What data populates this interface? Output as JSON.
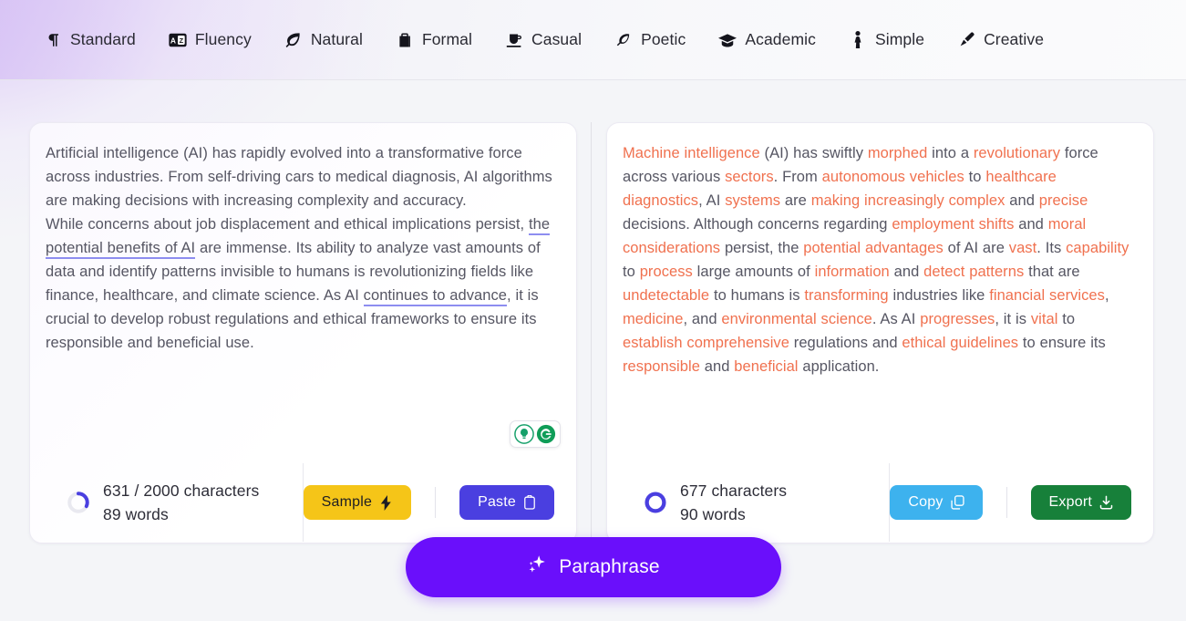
{
  "tabs": [
    {
      "label": "Standard",
      "icon": "pilcrow-icon",
      "active": true
    },
    {
      "label": "Fluency",
      "icon": "translate-icon",
      "active": false
    },
    {
      "label": "Natural",
      "icon": "leaf-icon",
      "active": false
    },
    {
      "label": "Formal",
      "icon": "briefcase-icon",
      "active": false
    },
    {
      "label": "Casual",
      "icon": "coffee-cup-icon",
      "active": false
    },
    {
      "label": "Poetic",
      "icon": "feather-icon",
      "active": false
    },
    {
      "label": "Academic",
      "icon": "graduation-cap-icon",
      "active": false
    },
    {
      "label": "Simple",
      "icon": "person-icon",
      "active": false
    },
    {
      "label": "Creative",
      "icon": "paintbrush-icon",
      "active": false
    }
  ],
  "input_panel": {
    "text_segments": [
      {
        "text": "Artificial intelligence (AI) has rapidly evolved into a transformative force across industries. From self-driving cars to medical diagnosis, AI algorithms are making decisions with increasing complexity and accuracy.",
        "style": "plain"
      },
      {
        "text": "While concerns about job displacement and ethical implications persist, ",
        "style": "plain"
      },
      {
        "text": "the potential benefits of AI",
        "style": "suggestion-underline"
      },
      {
        "text": " are immense. Its ability to analyze vast amounts of data and identify patterns invisible to humans is revolutionizing fields like finance, healthcare, and climate science. As AI ",
        "style": "plain"
      },
      {
        "text": "continues to advance",
        "style": "suggestion-underline"
      },
      {
        "text": ", it is crucial to develop robust regulations and ethical frameworks to ensure its responsible and beneficial use.",
        "style": "plain"
      }
    ],
    "paragraph_1": "Artificial intelligence (AI) has rapidly evolved into a transformative force across industries. From self-driving cars to medical diagnosis, AI algorithms are making decisions with increasing complexity and accuracy.",
    "p2_pre": "While concerns about job displacement and ethical implications persist, ",
    "p2_underline_1": "the potential benefits of AI",
    "p2_mid": " are immense. Its ability to analyze vast amounts of data and identify patterns invisible to humans is revolutionizing fields like finance, healthcare, and climate science. As AI ",
    "p2_underline_2": "continues to advance",
    "p2_post": ", it is crucial to develop robust regulations and ethical frameworks to ensure its responsible and beneficial use.",
    "assist_icons": [
      "lightbulb-icon",
      "grammarly-g-icon"
    ],
    "stats": {
      "characters": "631 / 2000 characters",
      "words": "89 words",
      "char_count": 631,
      "char_limit": 2000,
      "word_count": 89,
      "progress_percent": 32
    },
    "buttons": {
      "sample_label": "Sample",
      "sample_icon": "lightning-bolt-icon",
      "paste_label": "Paste",
      "paste_icon": "clipboard-icon"
    }
  },
  "output_panel": {
    "segments": [
      {
        "t": "Machine intelligence",
        "h": true
      },
      {
        "t": " (AI) has swiftly ",
        "h": false
      },
      {
        "t": "morphed",
        "h": true
      },
      {
        "t": " into a ",
        "h": false
      },
      {
        "t": "revolutionary",
        "h": true
      },
      {
        "t": " force across various ",
        "h": false
      },
      {
        "t": "sectors",
        "h": true
      },
      {
        "t": ". From ",
        "h": false
      },
      {
        "t": "autonomous vehicles",
        "h": true
      },
      {
        "t": " to ",
        "h": false
      },
      {
        "t": "healthcare diagnostics",
        "h": true
      },
      {
        "t": ", AI ",
        "h": false
      },
      {
        "t": "systems",
        "h": true
      },
      {
        "t": " are ",
        "h": false
      },
      {
        "t": "making increasingly complex",
        "h": true
      },
      {
        "t": " and ",
        "h": false
      },
      {
        "t": "precise",
        "h": true
      },
      {
        "t": " decisions. Although concerns regarding ",
        "h": false
      },
      {
        "t": "employment shifts",
        "h": true
      },
      {
        "t": " and ",
        "h": false
      },
      {
        "t": "moral considerations",
        "h": true
      },
      {
        "t": " persist, the ",
        "h": false
      },
      {
        "t": "potential advantages",
        "h": true
      },
      {
        "t": " of AI are ",
        "h": false
      },
      {
        "t": "vast",
        "h": true
      },
      {
        "t": ". Its ",
        "h": false
      },
      {
        "t": "capability",
        "h": true
      },
      {
        "t": " to ",
        "h": false
      },
      {
        "t": "process",
        "h": true
      },
      {
        "t": " large amounts of ",
        "h": false
      },
      {
        "t": "information",
        "h": true
      },
      {
        "t": " and ",
        "h": false
      },
      {
        "t": "detect patterns",
        "h": true
      },
      {
        "t": " that are ",
        "h": false
      },
      {
        "t": "undetectable",
        "h": true
      },
      {
        "t": " to humans is ",
        "h": false
      },
      {
        "t": "transforming",
        "h": true
      },
      {
        "t": " industries like ",
        "h": false
      },
      {
        "t": "financial services",
        "h": true
      },
      {
        "t": ", ",
        "h": false
      },
      {
        "t": "medicine",
        "h": true
      },
      {
        "t": ", and ",
        "h": false
      },
      {
        "t": "environmental science",
        "h": true
      },
      {
        "t": ". As AI ",
        "h": false
      },
      {
        "t": "progresses",
        "h": true
      },
      {
        "t": ", it is ",
        "h": false
      },
      {
        "t": "vital",
        "h": true
      },
      {
        "t": " to ",
        "h": false
      },
      {
        "t": "establish comprehensive",
        "h": true
      },
      {
        "t": " regulations and ",
        "h": false
      },
      {
        "t": "ethical guidelines",
        "h": true
      },
      {
        "t": " to ensure its ",
        "h": false
      },
      {
        "t": "responsible",
        "h": true
      },
      {
        "t": " and ",
        "h": false
      },
      {
        "t": "beneficial",
        "h": true
      },
      {
        "t": " application.",
        "h": false
      }
    ],
    "full_text": "Machine intelligence (AI) has swiftly morphed into a revolutionary force across various sectors. From autonomous vehicles to healthcare diagnostics, AI systems are making increasingly complex and precise decisions. Although concerns regarding employment shifts and moral considerations persist, the potential advantages of AI are vast. Its capability to process large amounts of information and detect patterns that are undetectable to humans is transforming industries like financial services, medicine, and environmental science. As AI progresses, it is vital to establish comprehensive regulations and ethical guidelines to ensure its responsible and beneficial application.",
    "stats": {
      "characters": "677 characters",
      "words": "90 words",
      "char_count": 677,
      "word_count": 90,
      "progress_percent": 100
    },
    "buttons": {
      "copy_label": "Copy",
      "copy_icon": "copy-icon",
      "export_label": "Export",
      "export_icon": "download-icon"
    }
  },
  "cta": {
    "label": "Paraphrase",
    "icon": "sparkle-icon"
  },
  "colors": {
    "accent_purple": "#6a0ffb",
    "paste_blue": "#4a3fe0",
    "sample_yellow": "#f5c518",
    "copy_blue": "#3db2ee",
    "export_green": "#17803a",
    "highlight_orange": "#f0714f",
    "suggestion_underline": "#8d8df0",
    "page_bg": "#f4f5f8"
  }
}
